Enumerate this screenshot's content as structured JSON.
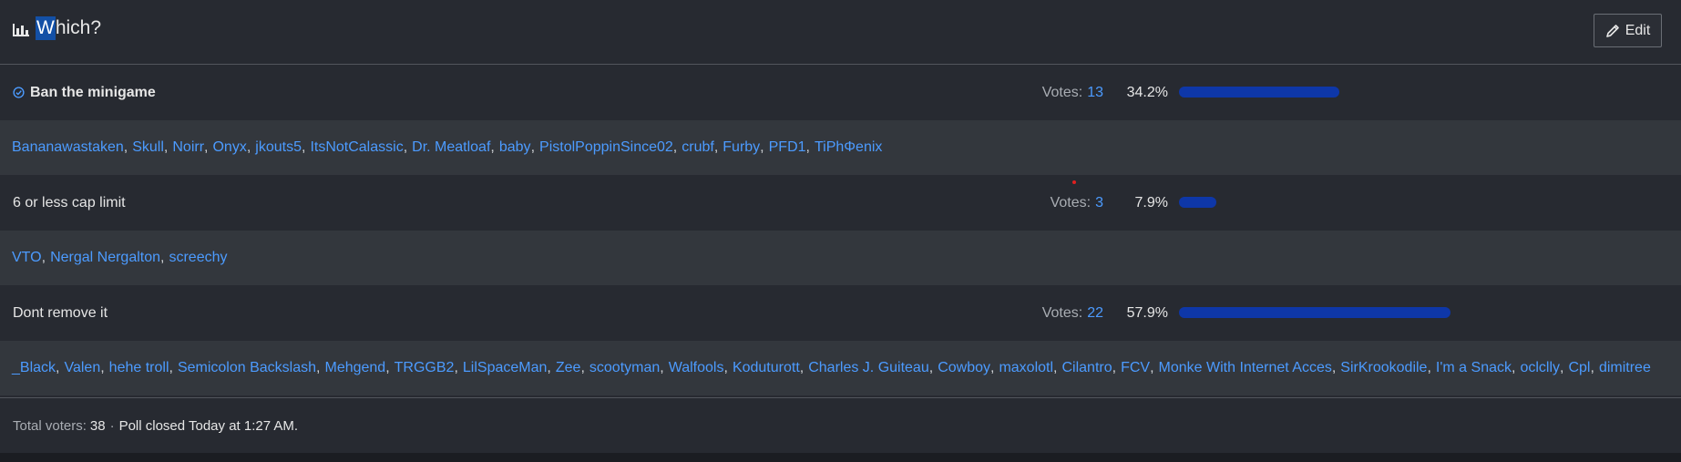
{
  "poll": {
    "title_prefix": "W",
    "title_rest": "hich?",
    "edit_label": "Edit",
    "votes_label": "Votes:",
    "choices": [
      {
        "label": "Ban the minigame",
        "winner": true,
        "votes": "13",
        "percent": "34.2%",
        "fraction": 0.342,
        "voters": [
          "Bananawastaken",
          "Skull",
          "Noirr",
          "Onyx",
          "jkouts5",
          "ItsNotCalassic",
          "Dr. Meatloaf",
          "baby",
          "PistolPoppinSince02",
          "crubf",
          "Furby",
          "PFD1",
          "TiPhΦenix"
        ]
      },
      {
        "label": "6 or less cap limit",
        "winner": false,
        "votes": "3",
        "percent": "7.9%",
        "fraction": 0.079,
        "voters": [
          "VTO",
          "Nergal Nergalton",
          "screechy"
        ]
      },
      {
        "label": "Dont remove it",
        "winner": false,
        "votes": "22",
        "percent": "57.9%",
        "fraction": 0.579,
        "voters": [
          "_Black",
          "Valen",
          "hehe troll",
          "Semicolon Backslash",
          "Mehgend",
          "TRGGB2",
          "LilSpaceMan",
          "Zee",
          "scootyman",
          "Walfools",
          "Koduturott",
          "Charles J. Guiteau",
          "Cowboy",
          "maxolotl",
          "Cilantro",
          "FCV",
          "Monke With Internet Acces",
          "SirKrookodile",
          "I'm a Snack",
          "oclclly",
          "Cpl",
          "dimitree"
        ]
      }
    ],
    "footer": {
      "total_label": "Total voters:",
      "total_value": "38",
      "separator": "·",
      "closed_text": "Poll closed Today at 1:27 AM."
    }
  },
  "colors": {
    "bar": "#0e37a8",
    "link": "#4c9bff",
    "highlight": "#1350a6"
  }
}
